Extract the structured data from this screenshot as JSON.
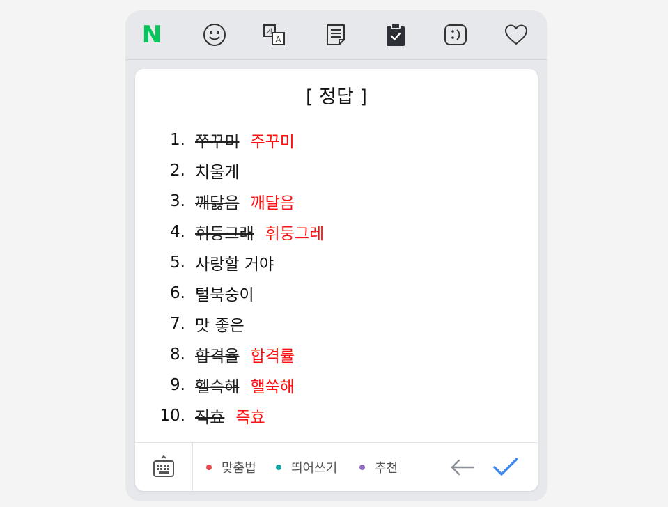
{
  "toolbar": {
    "icons": [
      "naver-logo-icon",
      "emoji-icon",
      "translate-icon",
      "memo-icon",
      "clipboard-icon",
      "emoticon-icon",
      "favorites-heart-icon"
    ],
    "naver_logo": "N",
    "brand_color": "#03c75a"
  },
  "answer": {
    "title": "[ 정답 ]",
    "items": [
      {
        "num": "1.",
        "wrong": "쭈꾸미",
        "fix": "주꾸미"
      },
      {
        "num": "2.",
        "text": "치울게"
      },
      {
        "num": "3.",
        "wrong": "깨닳음",
        "fix": "깨달음"
      },
      {
        "num": "4.",
        "wrong": "휘둥그래",
        "fix": "휘둥그레"
      },
      {
        "num": "5.",
        "text": "사랑할 거야"
      },
      {
        "num": "6.",
        "text": "털북숭이"
      },
      {
        "num": "7.",
        "text": "맛 좋은"
      },
      {
        "num": "8.",
        "wrong": "합격율",
        "fix": "합격률"
      },
      {
        "num": "9.",
        "wrong": "헬슥해",
        "fix": "핼쑥해"
      },
      {
        "num": "10.",
        "wrong": "직효",
        "fix": "즉효"
      }
    ],
    "correction_color": "#ff1111"
  },
  "footer": {
    "options": [
      {
        "label": "맞춤법",
        "color": "#e5484d"
      },
      {
        "label": "띄어쓰기",
        "color": "#13a3a3"
      },
      {
        "label": "추천",
        "color": "#8e6bbf"
      }
    ],
    "icons": [
      "keyboard-icon",
      "back-arrow-icon",
      "check-icon"
    ],
    "check_color": "#3f86ee"
  }
}
